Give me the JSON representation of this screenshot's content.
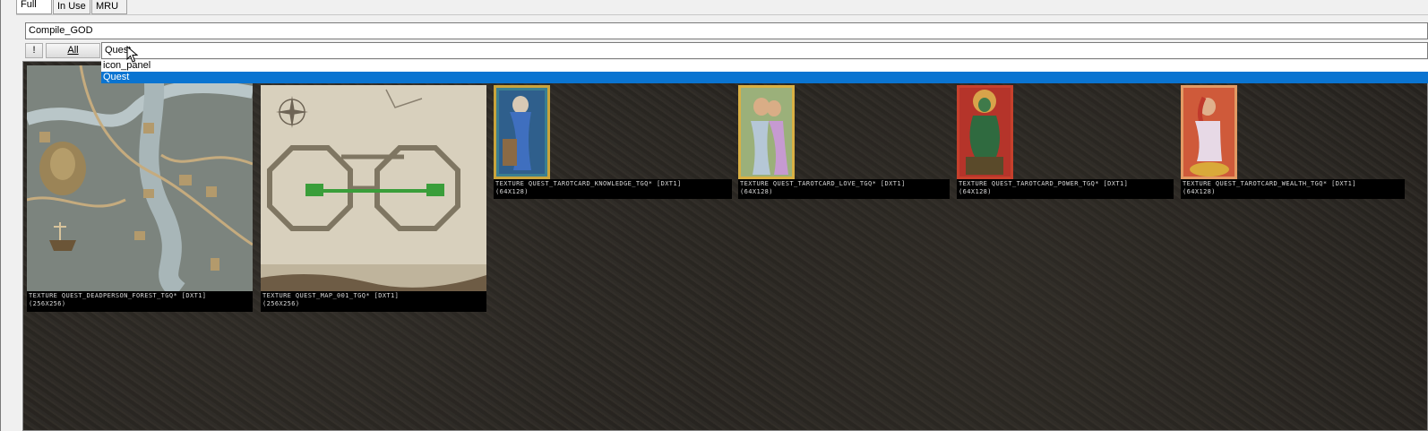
{
  "tabs": [
    {
      "label": "Full",
      "active": true
    },
    {
      "label": "In Use",
      "active": false
    },
    {
      "label": "MRU",
      "active": false
    }
  ],
  "compile_field": {
    "value": "Compile_GOD"
  },
  "toolbar": {
    "bang_label": "!",
    "all_label": "All"
  },
  "filter_field": {
    "value": "Quest"
  },
  "dropdown": {
    "items": [
      {
        "label": "icon_panel",
        "selected": false
      },
      {
        "label": "Quest",
        "selected": true
      }
    ]
  },
  "textures": [
    {
      "name": "TEXTURE QUEST_DEADPERSON_FOREST_TGQ* [DXT1]",
      "size": "(256X256)",
      "kind": "forest-map"
    },
    {
      "name": "TEXTURE QUEST_MAP_001_TGQ* [DXT1]",
      "size": "(256X256)",
      "kind": "dungeon-map"
    },
    {
      "name": "TEXTURE QUEST_TAROTCARD_KNOWLEDGE_TGQ* [DXT1]",
      "size": "(64X128)",
      "kind": "tarot-knowledge"
    },
    {
      "name": "TEXTURE QUEST_TAROTCARD_LOVE_TGQ* [DXT1]",
      "size": "(64X128)",
      "kind": "tarot-love"
    },
    {
      "name": "TEXTURE QUEST_TAROTCARD_POWER_TGQ* [DXT1]",
      "size": "(64X128)",
      "kind": "tarot-power"
    },
    {
      "name": "TEXTURE QUEST_TAROTCARD_WEALTH_TGQ* [DXT1]",
      "size": "(64X128)",
      "kind": "tarot-wealth"
    }
  ],
  "colors": {
    "selection": "#0a74d1",
    "viewer_bg": "#28251f",
    "caption_bg": "#000000"
  }
}
